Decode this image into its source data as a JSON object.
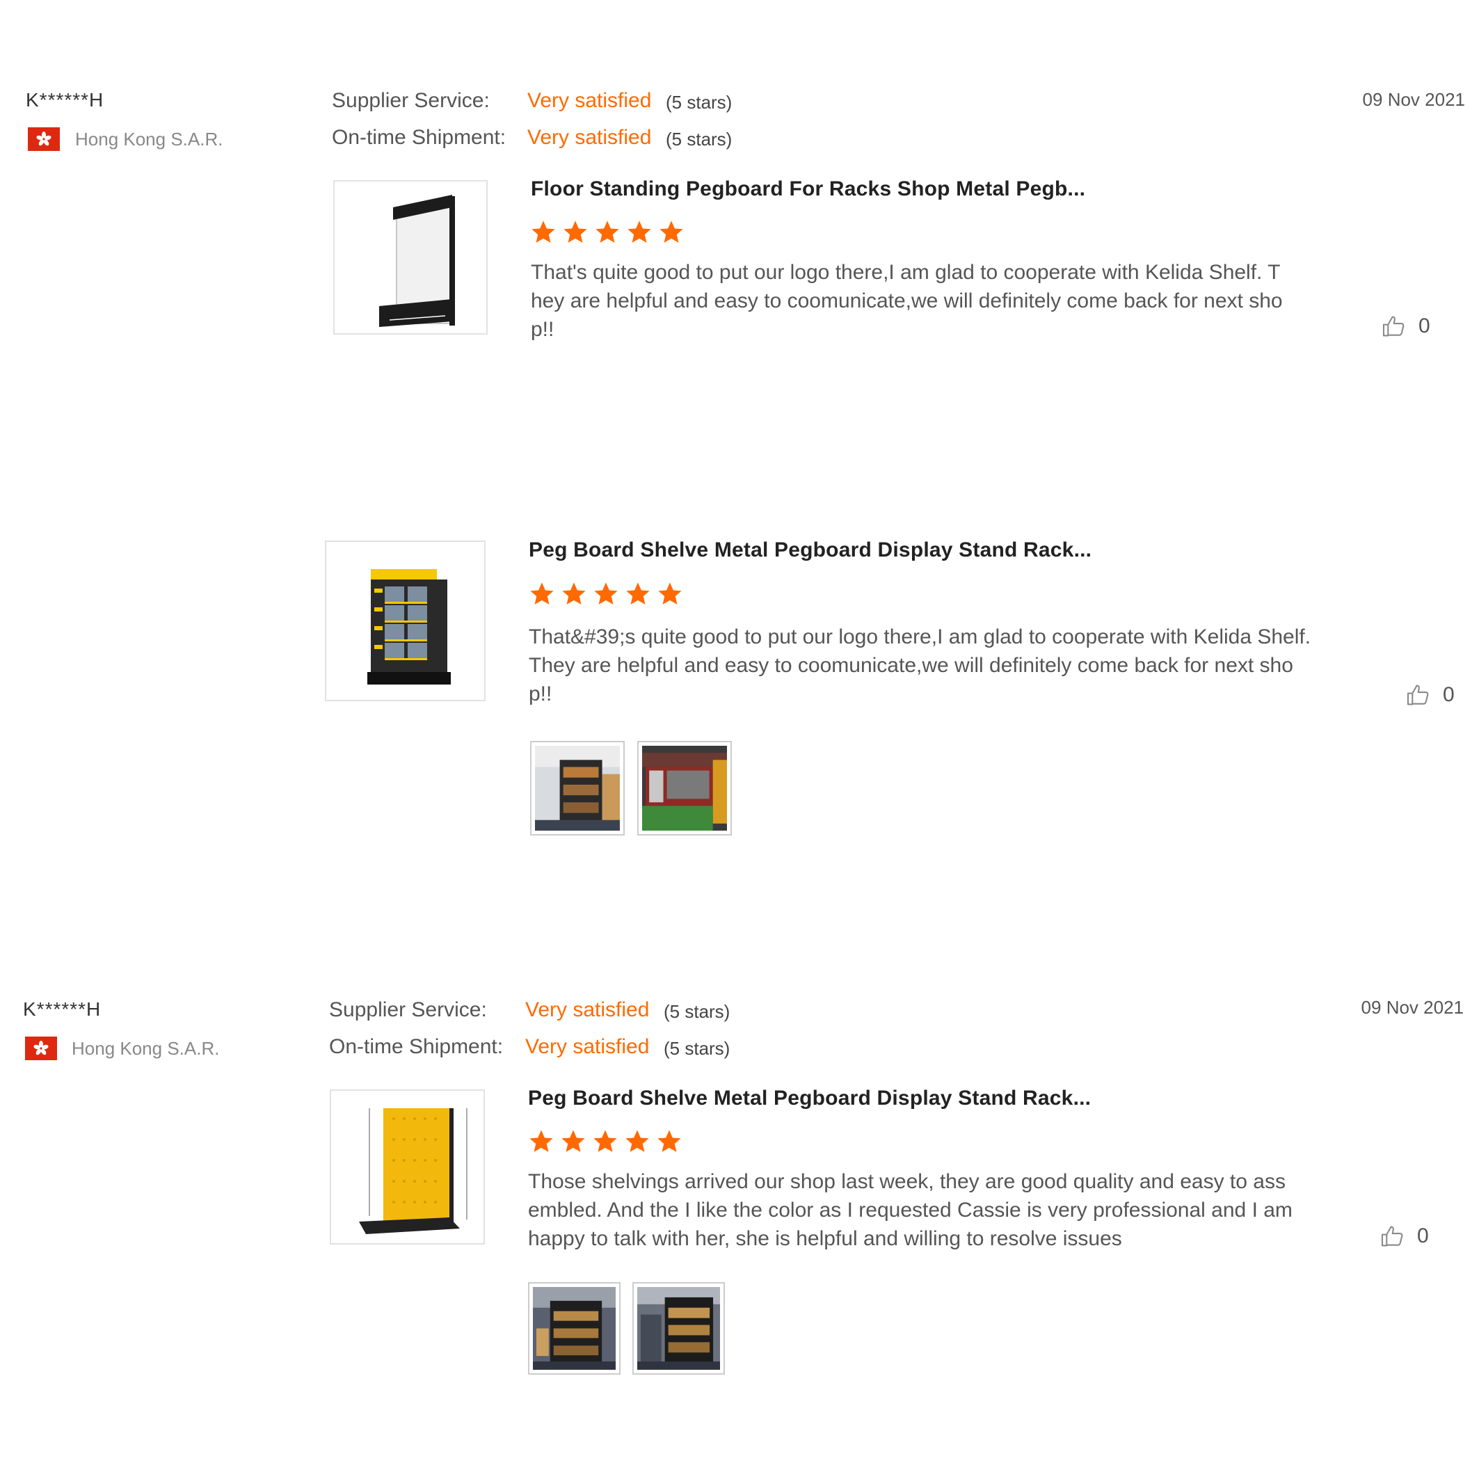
{
  "colors": {
    "accent": "#ff6a00",
    "text": "#333333",
    "muted": "#888888"
  },
  "reviews": [
    {
      "buyer": {
        "name": "K******H",
        "country": "Hong Kong S.A.R.",
        "flag_icon": "hong-kong-flag-icon"
      },
      "supplier_service": {
        "label": "Supplier Service:",
        "value": "Very satisfied",
        "stars_text": "(5 stars)"
      },
      "shipment": {
        "label": "On-time Shipment:",
        "value": "Very satisfied",
        "stars_text": "(5 stars)"
      },
      "date": "09 Nov 2021",
      "items": [
        {
          "product_title": "Floor Standing Pegboard For Racks Shop Metal Pegb...",
          "rating": 5,
          "text": "That's quite good to put our logo there,I am glad to cooperate with Kelida Shelf. They are helpful and easy to coomunicate,we will definitely come back for next shop!!",
          "likes": "0",
          "photo_count": 0
        },
        {
          "product_title": "Peg Board Shelve Metal Pegboard Display Stand Rack...",
          "rating": 5,
          "text": "That&#39;s quite good to put our logo there,I am glad to cooperate with Kelida Shelf. They are helpful and easy to coomunicate,we will definitely come back for next shop!!",
          "likes": "0",
          "photo_count": 2
        }
      ]
    },
    {
      "buyer": {
        "name": "K******H",
        "country": "Hong Kong S.A.R.",
        "flag_icon": "hong-kong-flag-icon"
      },
      "supplier_service": {
        "label": "Supplier Service:",
        "value": "Very satisfied",
        "stars_text": "(5 stars)"
      },
      "shipment": {
        "label": "On-time Shipment:",
        "value": "Very satisfied",
        "stars_text": "(5 stars)"
      },
      "date": "09 Nov 2021",
      "items": [
        {
          "product_title": "Peg Board Shelve Metal Pegboard Display Stand Rack...",
          "rating": 5,
          "text": "Those shelvings arrived our shop last week, they are good quality and easy to assembled. And the I like the color as I requested Cassie is very professional and I am happy to talk with her, she is helpful and willing to resolve issues",
          "likes": "0",
          "photo_count": 2
        }
      ]
    }
  ]
}
